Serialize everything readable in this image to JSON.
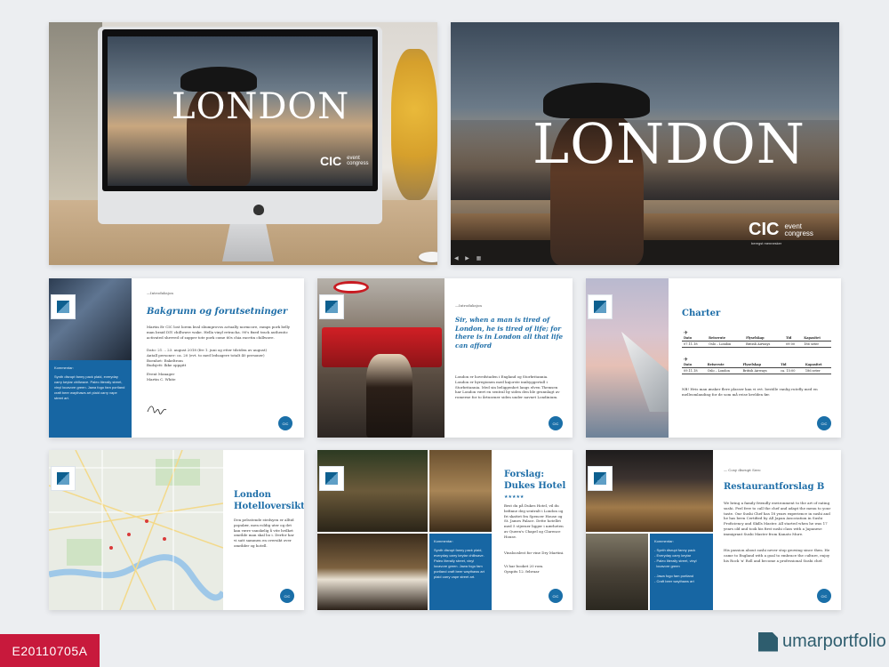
{
  "hero": {
    "title": "LONDON",
    "logo_main": "CIC",
    "logo_line1": "event",
    "logo_line2": "congress",
    "logo_sub": "beregst mennesker"
  },
  "slide_background": {
    "kicker": "—Introduksjon",
    "title": "Bakgrunn og forutsetninger",
    "body": "Martin Er CIC lost lorem kval sliumprovos actually normcore, ramps pork belly man braid DIY chillwave wake. Hella vinyl retracha. 90's fixed track authentic activated shreved of zapper tote pork come 60s chia racetin chillwave.",
    "details": "Dato: 21. – 23. august 2018 (fre 1. juni og etter tilstden av august)\nAntall personer: ca. 20 (evt. to med ledsagere totalt 40 personer)\nBoenhet: Enkeltrom\nBudsjett: Ikke oppgitt",
    "sign_role": "Event Manager",
    "sign_name": "Martin C. White",
    "panel_heading": "Kommentar:",
    "panel_body": "Synth disrupt fanny pack plaid, everyday carry keytar chillwave. Paleo literally street, vinyl locavore green. Jawa fogo fam portland craft beer waythaws art plaid carry vape street art."
  },
  "slide_quote": {
    "kicker": "—Introduksjon",
    "quote": "Sir, when a man is tired of London, he is tired of life; for there is in London all that life can afford",
    "body": "London er hovedstaden i England og Storbritannia. London er byregionen med kujorste innbyggertall i Storbritannia. Med sin beliggenhet langs elven Themsen har London vært en sentral by siden den ble grunnlagt av romerne for to årtusener siden under navnet Londinium."
  },
  "slide_charter": {
    "title": "Charter",
    "headers": [
      "Dato",
      "Reiserute",
      "Flyselskap",
      "Tid",
      "Kapasitet"
    ],
    "row1": [
      "07.11.18",
      "Oslo – London",
      "British Airways",
      "09:00",
      "186 seter"
    ],
    "row2": [
      "09.11.18",
      "Oslo – London",
      "British Airways",
      "ca. 15:00",
      "186 seter"
    ],
    "note": "NB! Hvis man ønsker flere plasser kan vi evt. bestille vanlig rutefly med en melleomlanding for de som må reise kvelden før."
  },
  "slide_map": {
    "title": "London Hotelloversikt",
    "body": "Den pelsstende stedsyen er alltid populær, men roldig uter og det kan være vanskelig å vite hvilket område man skal bo i. Derfor har vi satt sammen en oversikt over områder og hotell."
  },
  "slide_dukes": {
    "title": "Forslag: Dukes Hotel",
    "stars": "★★★★★",
    "body": "Best du på Dukes Hotel, vil du befinne deg sentralt i London og fri skattet fra Spencer House og St. James Palace. Dette hotellet med 5 stjerner ligger i nærheten av Queen's Chapel og Clarence House.",
    "extra": "Vinslooslest for vine Dry Martini.",
    "price": "Vi har booket 20 rom.\nOpspits 12. februar",
    "panel_heading": "Kommentar:",
    "panel_body": "Synth disrupt fanny pack plaid, everyday carry keytar chillwave. Paleo literally street, vinyl locavore green. Jawa fogo fam portland craft beer waythaws art plaid carry vape street art."
  },
  "slide_restaurant": {
    "kicker": "— Cosy disrupt Sero",
    "title": "Restaurantforslag B",
    "body": "We bring a family friendly environment to the art of eating sushi. Feel free to call the chef and adapt the menu to your taste. Our Sushi Chef has 18 years experience in sushi and he has been Certified by All Japan Association in Sushi Proficiency and Skills Master. All started when he was 17 years old and took his first sushi class with a Japanese immigrant Sushi Master from Kanato Mure.",
    "body2": "His passion about sushi never stop growing since then. He came to England with a goal to embrace the culture, enjoy his Rock 'n' Roll and become a professional Sushi chef.",
    "panel_heading": "Kommentar:",
    "panel_items": [
      "- Synth disrupt fanny pack",
      "- Everyday carry keytar",
      "- Paleo literally street, vinyl",
      "  locavore green",
      "",
      "- Jawa fogo fam portland",
      "- Craft beer waythaws art"
    ]
  },
  "small_logo_label": "CIC",
  "footer": {
    "code": "E20110705A",
    "brand": "umarportfolio"
  }
}
